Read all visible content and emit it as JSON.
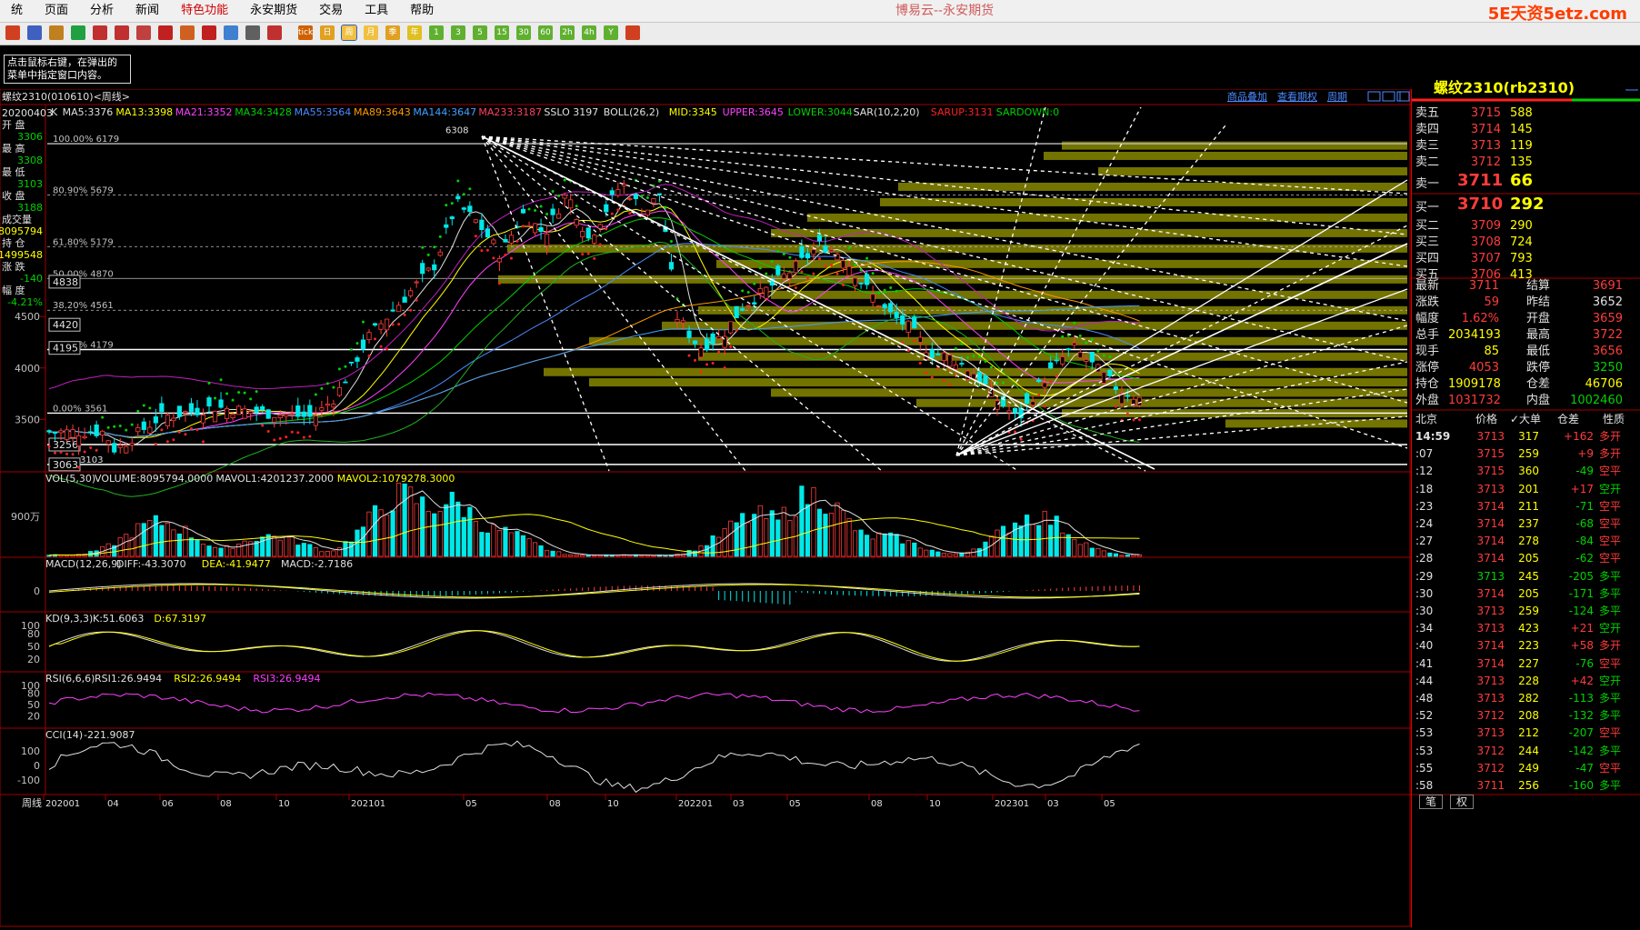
{
  "menubar": {
    "items": [
      {
        "label": "统",
        "hot": false
      },
      {
        "label": "页面",
        "hot": false
      },
      {
        "label": "分析",
        "hot": false
      },
      {
        "label": "新闻",
        "hot": false
      },
      {
        "label": "特色功能",
        "hot": true
      },
      {
        "label": "永安期货",
        "hot": false
      },
      {
        "label": "交易",
        "hot": false
      },
      {
        "label": "工具",
        "hot": false
      },
      {
        "label": "帮助",
        "hot": false
      }
    ],
    "app_title": "博易云--永安期货",
    "watermark": "5E天资5etz.com"
  },
  "toolbar": {
    "icons": [
      "home-icon",
      "print-icon",
      "file-icon",
      "refresh-icon",
      "zoom-in-icon",
      "zoom-out-icon",
      "window-icon",
      "draw-icon",
      "paint-icon",
      "tool-icon",
      "new-icon",
      "table-icon",
      "chart-icon",
      "tick-icon",
      "day-icon",
      "week-icon",
      "month-icon",
      "season-icon",
      "year-icon",
      "min1-icon",
      "min3-icon",
      "min5-icon",
      "min15-icon",
      "min30-icon",
      "min60-icon",
      "min2h-icon",
      "min4h-icon",
      "custom-icon",
      "calc-icon"
    ],
    "labels": [
      "",
      "",
      "",
      "",
      "",
      "",
      "",
      "",
      "",
      "",
      "",
      "",
      "",
      "tick",
      "日",
      "周",
      "月",
      "季",
      "年",
      "1",
      "3",
      "5",
      "15",
      "30",
      "60",
      "2h",
      "4h",
      "Y",
      ""
    ]
  },
  "tip": {
    "line1": "点击鼠标右键，在弹出的",
    "line2": "菜单中指定窗口内容。"
  },
  "chart_header": {
    "symbol": "螺纹2310(010610)<周线>",
    "links": [
      "商品叠加",
      "查看期权",
      "周期"
    ],
    "indicators": [
      {
        "text": "K",
        "color": "#e0e0e0"
      },
      {
        "text": "MA5:3376",
        "color": "#e0e0e0"
      },
      {
        "text": "MA13:3398",
        "color": "#ffff00"
      },
      {
        "text": "MA21:3352",
        "color": "#ff40ff"
      },
      {
        "text": "MA34:3428",
        "color": "#00d200"
      },
      {
        "text": "MA55:3564",
        "color": "#4a8aff"
      },
      {
        "text": "MA89:3643",
        "color": "#ff9900"
      },
      {
        "text": "MA144:3647",
        "color": "#40a0ff"
      },
      {
        "text": "MA233:3187",
        "color": "#ff4060"
      },
      {
        "text": "SSLO 3197",
        "color": "#e0e0e0"
      },
      {
        "text": "BOLL(26,2)",
        "color": "#e0e0e0"
      },
      {
        "text": "MID:3345",
        "color": "#ffff00"
      },
      {
        "text": "UPPER:3645",
        "color": "#ff40ff"
      },
      {
        "text": "LOWER:3044",
        "color": "#00d200"
      },
      {
        "text": "SAR(10,2,20)",
        "color": "#e0e0e0"
      },
      {
        "text": "SARUP:3131",
        "color": "#ff2020"
      },
      {
        "text": "SARDOWN:0",
        "color": "#00d200"
      }
    ]
  },
  "left_info": {
    "date": "20200403",
    "open_label": "开 盘",
    "open": "3306",
    "high_label": "最 高",
    "high": "3308",
    "low_label": "最 低",
    "low": "3103",
    "close_label": "收 盘",
    "close": "3188",
    "vol_label": "成交量",
    "vol": "8095794",
    "oi_label": "持 仓",
    "oi": "1499548",
    "chg_label": "涨 跌",
    "chg": "-140",
    "pct_label": "幅 度",
    "pct": "-4.21%"
  },
  "price_axis": {
    "labels": [
      "4500",
      "4000",
      "3500"
    ]
  },
  "fib_levels": [
    {
      "label": "100.00% 6179"
    },
    {
      "label": "80.90% 5679"
    },
    {
      "label": "61.80% 5179"
    },
    {
      "label": "50.00% 4870"
    },
    {
      "label": "38.20% 4561"
    },
    {
      "label": "23.60% 4179"
    },
    {
      "label": "0.00% 3561"
    }
  ],
  "price_boxes": [
    "4838",
    "4420",
    "4195",
    "3256",
    "3063"
  ],
  "peak_label": "6308",
  "low_label": "3103",
  "panels": {
    "vol": {
      "title": "VOL(5,30)",
      "parts": [
        {
          "text": "VOLUME:8095794.0000",
          "color": "#e0e0e0"
        },
        {
          "text": "MAVOL1:4201237.2000",
          "color": "#e0e0e0"
        },
        {
          "text": "MAVOL2:1079278.3000",
          "color": "#ffff00"
        }
      ],
      "axis": "900万"
    },
    "macd": {
      "title": "MACD(12,26,9)",
      "parts": [
        {
          "text": "DIFF:-43.3070",
          "color": "#e0e0e0"
        },
        {
          "text": "DEA:-41.9477",
          "color": "#ffff00"
        },
        {
          "text": "MACD:-2.7186",
          "color": "#e0e0e0"
        }
      ],
      "axis": "0"
    },
    "kd": {
      "title": "KD(9,3,3)",
      "parts": [
        {
          "text": "K:51.6063",
          "color": "#e0e0e0"
        },
        {
          "text": "D:67.3197",
          "color": "#ffff00"
        }
      ],
      "axis": [
        "100",
        "80",
        "50",
        "20"
      ]
    },
    "rsi": {
      "title": "RSI(6,6,6)",
      "parts": [
        {
          "text": "RSI1:26.9494",
          "color": "#e0e0e0"
        },
        {
          "text": "RSI2:26.9494",
          "color": "#ffff00"
        },
        {
          "text": "RSI3:26.9494",
          "color": "#ff40ff"
        }
      ],
      "axis": [
        "100",
        "80",
        "50",
        "20"
      ]
    },
    "cci": {
      "title": "CCI(14)",
      "parts": [
        {
          "text": "-221.9087",
          "color": "#e0e0e0"
        }
      ],
      "axis": [
        "100",
        "0",
        "-100"
      ]
    }
  },
  "time_axis": {
    "first": "周线",
    "labels": [
      "202001",
      "04",
      "06",
      "08",
      "10",
      "202101",
      "05",
      "08",
      "10",
      "202201",
      "03",
      "05",
      "08",
      "10",
      "202301",
      "03",
      "05"
    ]
  },
  "quote": {
    "title": "螺纹2310(rb2310)",
    "asks": [
      {
        "label": "卖五",
        "price": "3715",
        "vol": "588"
      },
      {
        "label": "卖四",
        "price": "3714",
        "vol": "145"
      },
      {
        "label": "卖三",
        "price": "3713",
        "vol": "119"
      },
      {
        "label": "卖二",
        "price": "3712",
        "vol": "135"
      },
      {
        "label": "卖一",
        "price": "3711",
        "vol": "66"
      }
    ],
    "bids": [
      {
        "label": "买一",
        "price": "3710",
        "vol": "292"
      },
      {
        "label": "买二",
        "price": "3709",
        "vol": "290"
      },
      {
        "label": "买三",
        "price": "3708",
        "vol": "724"
      },
      {
        "label": "买四",
        "price": "3707",
        "vol": "793"
      },
      {
        "label": "买五",
        "price": "3706",
        "vol": "413"
      }
    ],
    "stats": [
      {
        "l1": "最新",
        "v1": "3711",
        "c1": "red",
        "l2": "结算",
        "v2": "3691",
        "c2": "red"
      },
      {
        "l1": "涨跌",
        "v1": "59",
        "c1": "red",
        "l2": "昨结",
        "v2": "3652",
        "c2": "wht"
      },
      {
        "l1": "幅度",
        "v1": "1.62%",
        "c1": "red",
        "l2": "开盘",
        "v2": "3659",
        "c2": "red"
      },
      {
        "l1": "总手",
        "v1": "2034193",
        "c1": "yel",
        "l2": "最高",
        "v2": "3722",
        "c2": "red"
      },
      {
        "l1": "现手",
        "v1": "85",
        "c1": "yel",
        "l2": "最低",
        "v2": "3656",
        "c2": "red"
      },
      {
        "l1": "涨停",
        "v1": "4053",
        "c1": "red",
        "l2": "跌停",
        "v2": "3250",
        "c2": "green"
      },
      {
        "l1": "持仓",
        "v1": "1909178",
        "c1": "yel",
        "l2": "仓差",
        "v2": "46706",
        "c2": "yel"
      },
      {
        "l1": "外盘",
        "v1": "1031732",
        "c1": "red",
        "l2": "内盘",
        "v2": "1002460",
        "c2": "green"
      }
    ],
    "tick_header": {
      "c1": "北京",
      "c2": "价格",
      "c3": "✓大单",
      "c4": "仓差",
      "c5": "性质"
    },
    "ticks": [
      {
        "t": "14:59",
        "p": "3713",
        "v": "317",
        "d": "+162",
        "n": "多开",
        "pc": "red",
        "dc": "red",
        "nc": "red"
      },
      {
        "t": ":07",
        "p": "3715",
        "v": "259",
        "d": "+9",
        "n": "多开",
        "pc": "red",
        "dc": "red",
        "nc": "red"
      },
      {
        "t": ":12",
        "p": "3715",
        "v": "360",
        "d": "-49",
        "n": "空平",
        "pc": "red",
        "dc": "green",
        "nc": "red"
      },
      {
        "t": ":18",
        "p": "3713",
        "v": "201",
        "d": "+17",
        "n": "空开",
        "pc": "red",
        "dc": "red",
        "nc": "green"
      },
      {
        "t": ":23",
        "p": "3714",
        "v": "211",
        "d": "-71",
        "n": "空平",
        "pc": "red",
        "dc": "green",
        "nc": "red"
      },
      {
        "t": ":24",
        "p": "3714",
        "v": "237",
        "d": "-68",
        "n": "空平",
        "pc": "red",
        "dc": "green",
        "nc": "red"
      },
      {
        "t": ":27",
        "p": "3714",
        "v": "278",
        "d": "-84",
        "n": "空平",
        "pc": "red",
        "dc": "green",
        "nc": "red"
      },
      {
        "t": ":28",
        "p": "3714",
        "v": "205",
        "d": "-62",
        "n": "空平",
        "pc": "red",
        "dc": "green",
        "nc": "red"
      },
      {
        "t": ":29",
        "p": "3713",
        "v": "245",
        "d": "-205",
        "n": "多平",
        "pc": "green",
        "dc": "green",
        "nc": "green"
      },
      {
        "t": ":30",
        "p": "3714",
        "v": "205",
        "d": "-171",
        "n": "多平",
        "pc": "red",
        "dc": "green",
        "nc": "green"
      },
      {
        "t": ":30",
        "p": "3713",
        "v": "259",
        "d": "-124",
        "n": "多平",
        "pc": "red",
        "dc": "green",
        "nc": "green"
      },
      {
        "t": ":34",
        "p": "3713",
        "v": "423",
        "d": "+21",
        "n": "空开",
        "pc": "red",
        "dc": "red",
        "nc": "green"
      },
      {
        "t": ":40",
        "p": "3714",
        "v": "223",
        "d": "+58",
        "n": "多开",
        "pc": "red",
        "dc": "red",
        "nc": "red"
      },
      {
        "t": ":41",
        "p": "3714",
        "v": "227",
        "d": "-76",
        "n": "空平",
        "pc": "red",
        "dc": "green",
        "nc": "red"
      },
      {
        "t": ":44",
        "p": "3713",
        "v": "228",
        "d": "+42",
        "n": "空开",
        "pc": "red",
        "dc": "red",
        "nc": "green"
      },
      {
        "t": ":48",
        "p": "3713",
        "v": "282",
        "d": "-113",
        "n": "多平",
        "pc": "red",
        "dc": "green",
        "nc": "green"
      },
      {
        "t": ":52",
        "p": "3712",
        "v": "208",
        "d": "-132",
        "n": "多平",
        "pc": "red",
        "dc": "green",
        "nc": "green"
      },
      {
        "t": ":53",
        "p": "3713",
        "v": "212",
        "d": "-207",
        "n": "空平",
        "pc": "red",
        "dc": "green",
        "nc": "red"
      },
      {
        "t": ":53",
        "p": "3712",
        "v": "244",
        "d": "-142",
        "n": "多平",
        "pc": "red",
        "dc": "green",
        "nc": "green"
      },
      {
        "t": ":55",
        "p": "3712",
        "v": "249",
        "d": "-47",
        "n": "空平",
        "pc": "red",
        "dc": "green",
        "nc": "red"
      },
      {
        "t": ":58",
        "p": "3711",
        "v": "256",
        "d": "-160",
        "n": "多平",
        "pc": "red",
        "dc": "green",
        "nc": "green"
      }
    ],
    "bottom_tabs": [
      "笔",
      "权"
    ]
  },
  "colors": {
    "up": "#ff3c3c",
    "down": "#00e8e8",
    "grid": "#800000",
    "vbar": "#808000"
  }
}
